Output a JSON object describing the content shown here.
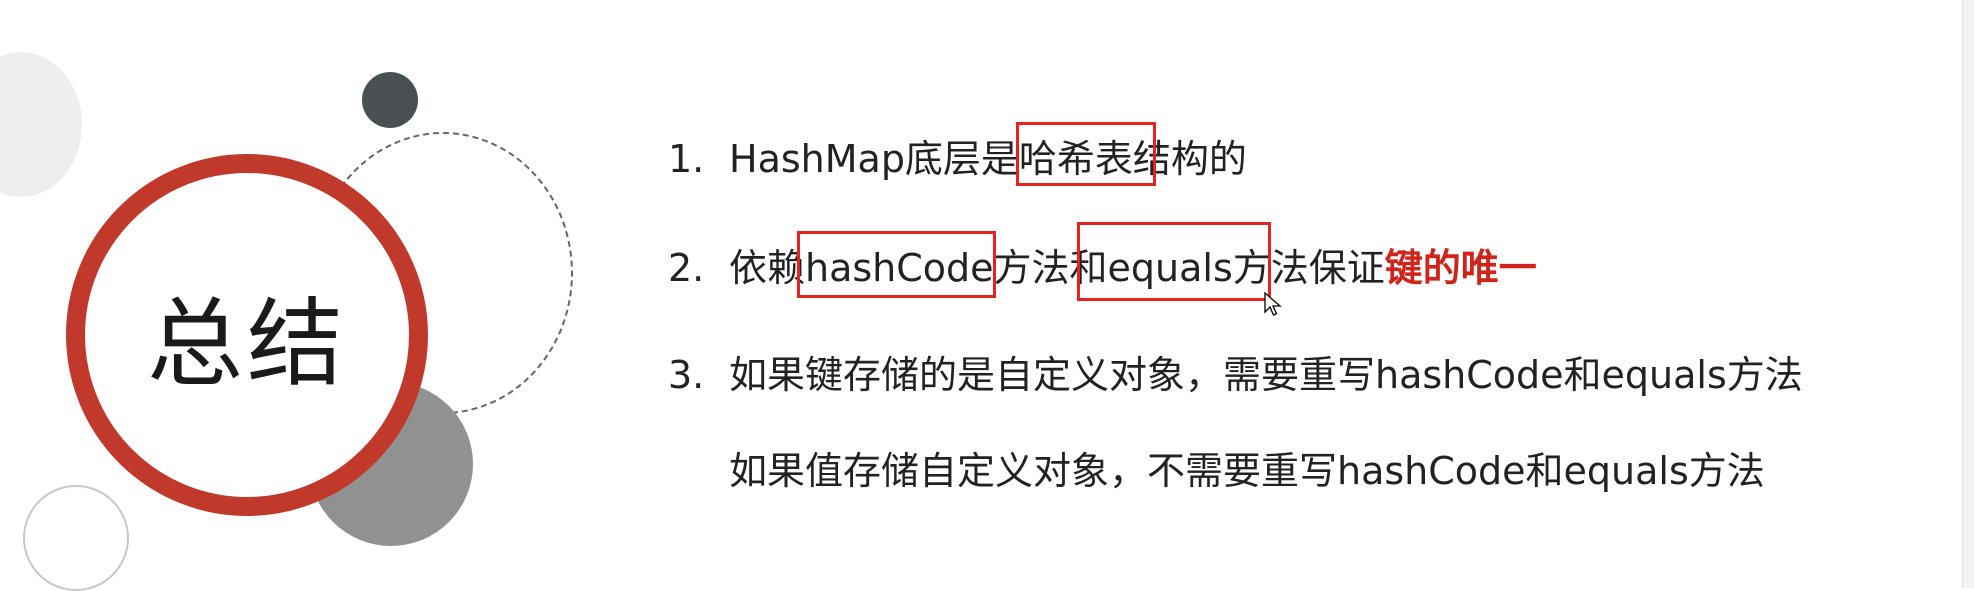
{
  "title": "总结",
  "items": [
    {
      "num": "1.",
      "text": "HashMap底层是哈希表结构的"
    },
    {
      "num": "2.",
      "text": "依赖hashCode方法和equals方法保证",
      "emphasis": "键的唯一"
    },
    {
      "num": "3.",
      "text": "如果键存储的是自定义对象，需要重写hashCode和equals方法"
    },
    {
      "num": "",
      "text": "如果值存储自定义对象，不需要重写hashCode和equals方法"
    }
  ],
  "colors": {
    "accent_red": "#c0392b",
    "highlight_box": "#e8231d",
    "emphasis_text": "#d0241a"
  }
}
